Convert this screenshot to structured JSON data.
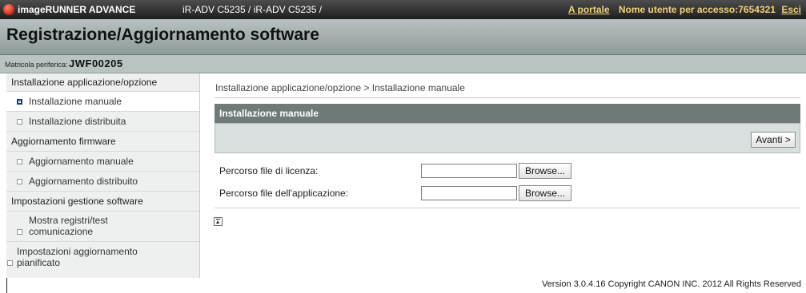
{
  "header": {
    "brand": "imageRUNNER ADVANCE",
    "model": "iR-ADV C5235 / iR-ADV C5235 /",
    "portal_link": "A portale",
    "user_label": "Nome utente per accesso:7654321",
    "logout": "Esci"
  },
  "page_title": "Registrazione/Aggiornamento software",
  "device": {
    "serial_label": "Matricola periferica:",
    "serial_value": "JWF00205"
  },
  "sidebar": {
    "items": [
      {
        "label": "Installazione applicazione/opzione",
        "type": "category"
      },
      {
        "label": "Installazione manuale",
        "type": "sub",
        "active": true
      },
      {
        "label": "Installazione distribuita",
        "type": "sub"
      },
      {
        "label": "Aggiornamento firmware",
        "type": "category"
      },
      {
        "label": "Aggiornamento manuale",
        "type": "sub"
      },
      {
        "label": "Aggiornamento distribuito",
        "type": "sub"
      },
      {
        "label": "Impostazioni gestione software",
        "type": "category"
      },
      {
        "label_line1": "Mostra registri/test",
        "label_line2": "comunicazione",
        "type": "sub"
      },
      {
        "label_line1": "Impostazioni aggiornamento",
        "label_line2": "pianificato",
        "type": "sub"
      }
    ]
  },
  "main": {
    "breadcrumb": "Installazione applicazione/opzione > Installazione manuale",
    "panel_title": "Installazione manuale",
    "next_button": "Avanti >",
    "license_label": "Percorso file di licenza:",
    "app_label": "Percorso file dell'applicazione:",
    "license_value": "",
    "app_value": "",
    "browse_label": "Browse..."
  },
  "footer": "Version 3.0.4.16 Copyright CANON INC. 2012 All Rights Reserved",
  "colors": {
    "topbar": "#2a2a2a",
    "titlebar": "#a3aeae",
    "panel_header": "#6f7a7a",
    "accent_link": "#f0d27a"
  }
}
